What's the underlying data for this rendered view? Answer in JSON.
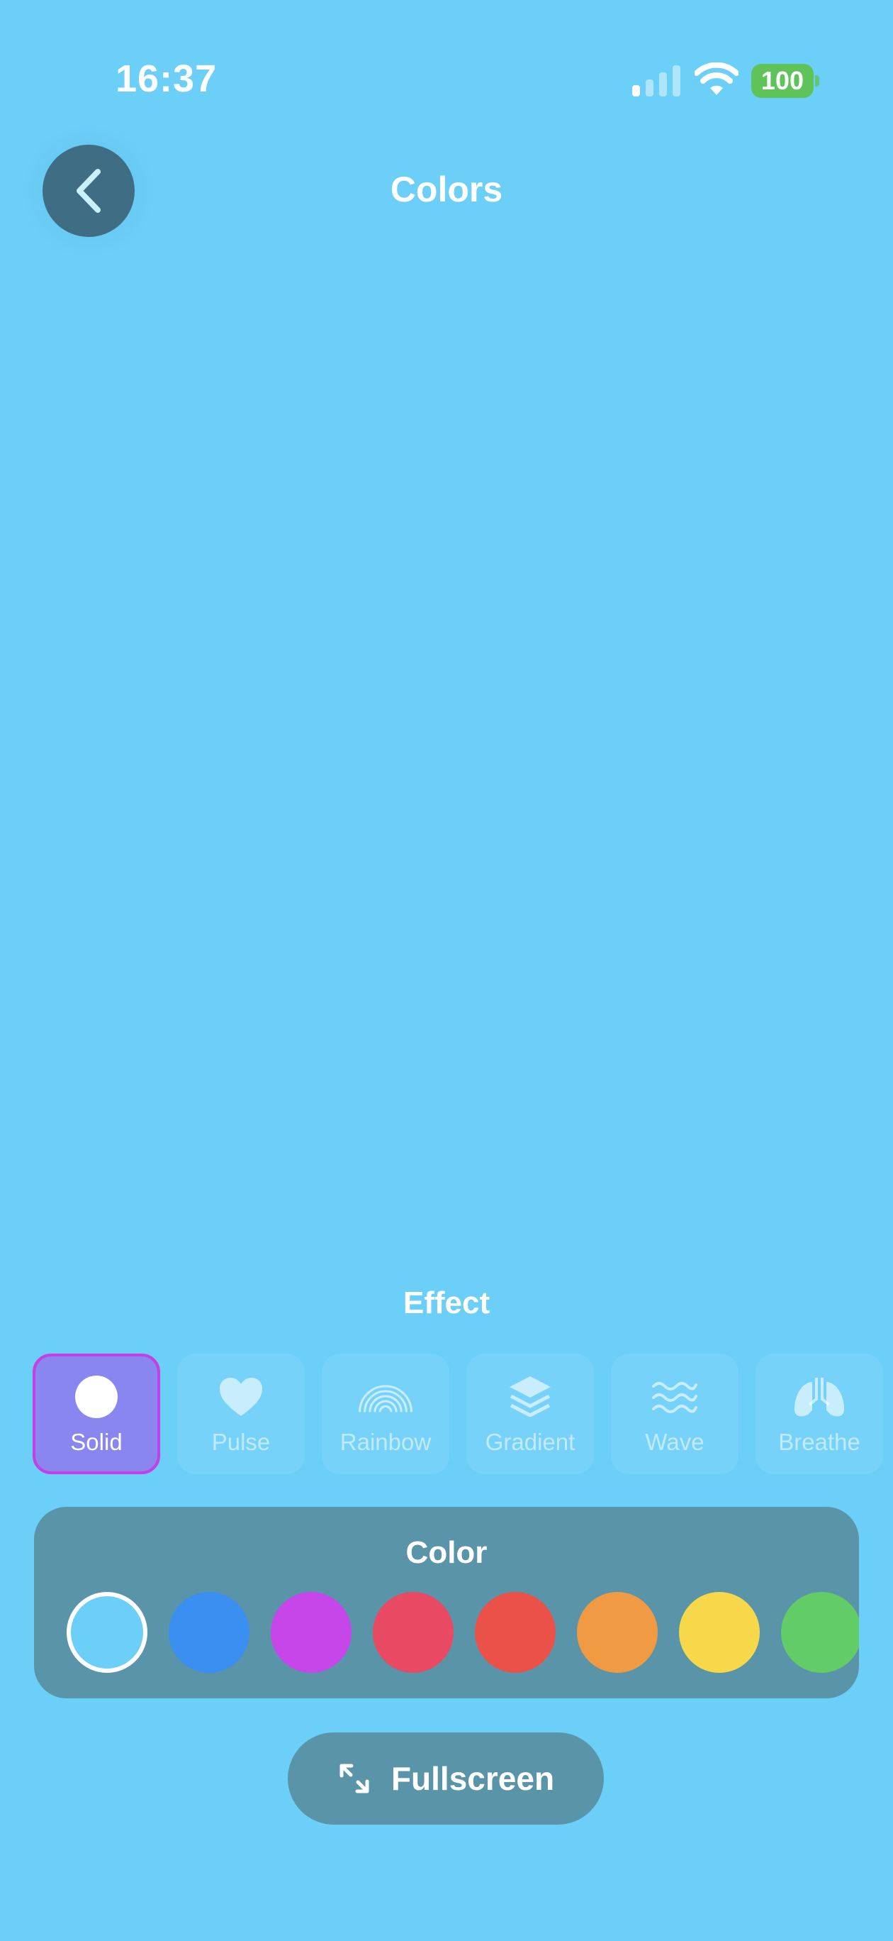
{
  "status_bar": {
    "time": "16:37",
    "battery": "100"
  },
  "header": {
    "title": "Colors"
  },
  "effects": {
    "title": "Effect",
    "items": [
      {
        "label": "Solid",
        "icon": "circle-icon",
        "active": true
      },
      {
        "label": "Pulse",
        "icon": "heart-icon",
        "active": false
      },
      {
        "label": "Rainbow",
        "icon": "rainbow-icon",
        "active": false
      },
      {
        "label": "Gradient",
        "icon": "layers-icon",
        "active": false
      },
      {
        "label": "Wave",
        "icon": "wave-icon",
        "active": false
      },
      {
        "label": "Breathe",
        "icon": "lungs-icon",
        "active": false
      }
    ]
  },
  "color_panel": {
    "title": "Color",
    "swatches": [
      {
        "color": "#6ccff8",
        "selected": true
      },
      {
        "color": "#3b8ff0",
        "selected": false
      },
      {
        "color": "#c646ea",
        "selected": false
      },
      {
        "color": "#e84a63",
        "selected": false
      },
      {
        "color": "#ea5149",
        "selected": false
      },
      {
        "color": "#f09a44",
        "selected": false
      },
      {
        "color": "#f7d84a",
        "selected": false
      },
      {
        "color": "#62cc66",
        "selected": false
      }
    ]
  },
  "fullscreen": {
    "label": "Fullscreen"
  },
  "colors": {
    "background": "#6ccff8",
    "panel": "#5a94a8",
    "accent": "#8a86ef",
    "accent_border": "#c43fe8"
  }
}
